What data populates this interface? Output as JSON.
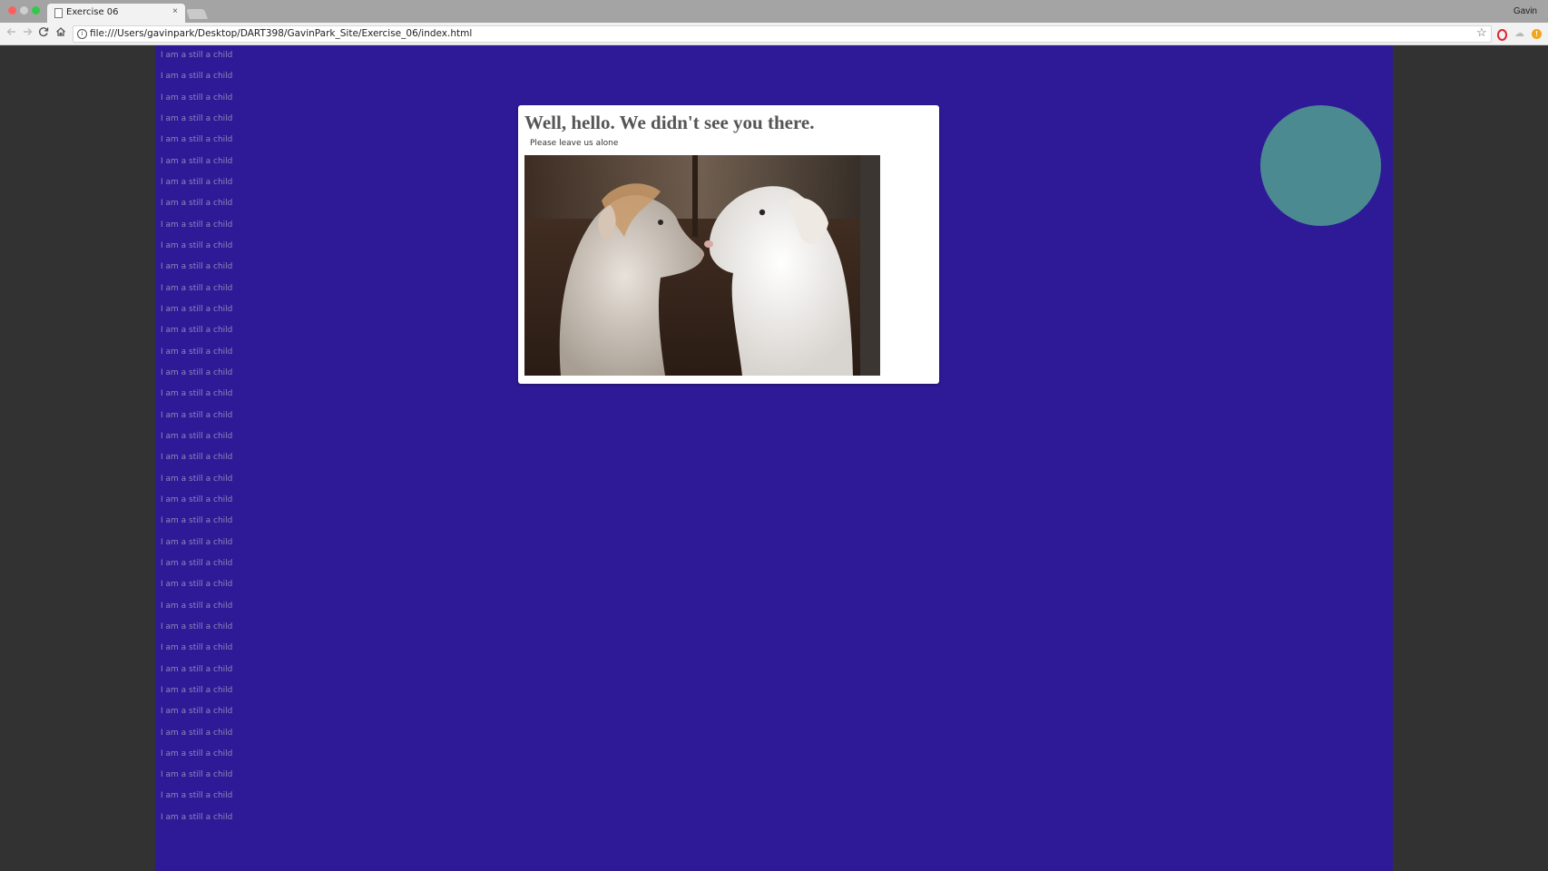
{
  "browser": {
    "tab": {
      "title": "Exercise 06",
      "close_glyph": "×"
    },
    "profile_name": "Gavin",
    "address_bar": {
      "url": "file:///Users/gavinpark/Desktop/DART398/GavinPark_Site/Exercise_06/index.html"
    },
    "icons": {
      "back": "arrow-left-icon",
      "forward": "arrow-right-icon",
      "reload": "reload-icon",
      "home": "home-icon",
      "info": "info-icon",
      "bookmark": "star-icon",
      "opera": "opera-extension-icon",
      "cloud": "cloud-extension-icon",
      "alert": "alert-extension-icon"
    }
  },
  "page": {
    "colors": {
      "body_background": "#2e1a97",
      "outer_background": "#323232",
      "card_background": "#ffffff",
      "circle": "#4c8a92",
      "child_text": "#8c86b8"
    },
    "child_items": [
      "I am a still a child",
      "I am a still a child",
      "I am a still a child",
      "I am a still a child",
      "I am a still a child",
      "I am a still a child",
      "I am a still a child",
      "I am a still a child",
      "I am a still a child",
      "I am a still a child",
      "I am a still a child",
      "I am a still a child",
      "I am a still a child",
      "I am a still a child",
      "I am a still a child",
      "I am a still a child",
      "I am a still a child",
      "I am a still a child",
      "I am a still a child",
      "I am a still a child",
      "I am a still a child",
      "I am a still a child",
      "I am a still a child",
      "I am a still a child",
      "I am a still a child",
      "I am a still a child",
      "I am a still a child",
      "I am a still a child",
      "I am a still a child",
      "I am a still a child",
      "I am a still a child",
      "I am a still a child",
      "I am a still a child",
      "I am a still a child",
      "I am a still a child",
      "I am a still a child",
      "I am a still a child"
    ],
    "card": {
      "title": "Well, hello. We didn't see you there.",
      "subtitle": "Please leave us alone",
      "image": "two-baby-goats-photo"
    }
  }
}
